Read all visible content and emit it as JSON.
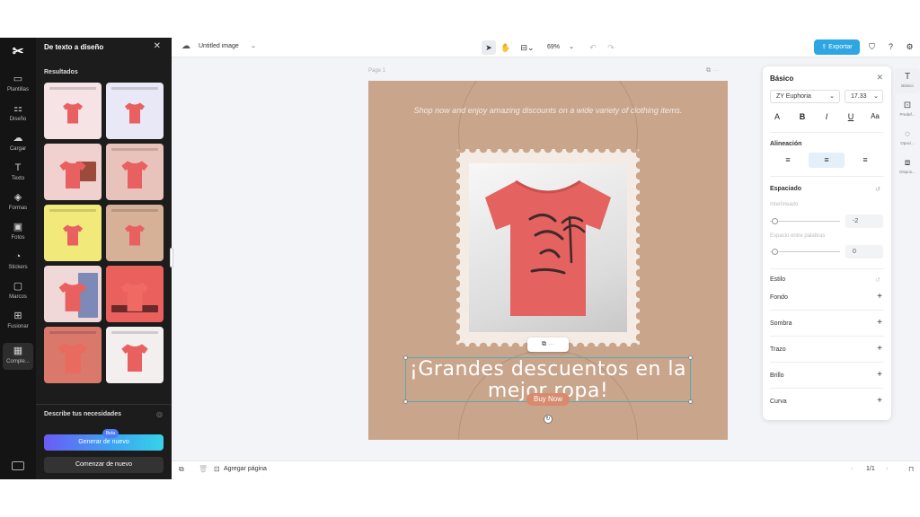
{
  "rail": {
    "items": [
      {
        "icon": "template-icon",
        "label": "Plantillas"
      },
      {
        "icon": "design-icon",
        "label": "Diseño"
      },
      {
        "icon": "upload-icon",
        "label": "Cargar"
      },
      {
        "icon": "text-icon",
        "label": "Texto"
      },
      {
        "icon": "shapes-icon",
        "label": "Formas"
      },
      {
        "icon": "photos-icon",
        "label": "Fotos"
      },
      {
        "icon": "stickers-icon",
        "label": "Stickers"
      },
      {
        "icon": "frames-icon",
        "label": "Marcos"
      },
      {
        "icon": "merge-icon",
        "label": "Fusionar"
      },
      {
        "icon": "apps-icon",
        "label": "Comple..."
      }
    ]
  },
  "left_panel": {
    "title": "De texto a diseño",
    "results_title": "Resultados",
    "describe_label": "Describe tus necesidades",
    "beta_badge": "Beta",
    "generate_button": "Generar de nuevo",
    "restart_button": "Comenzar de nuevo"
  },
  "topbar": {
    "doc_title": "Untitled image",
    "zoom": "69%",
    "export_label": "Exportar"
  },
  "canvas": {
    "page_label": "Page 1",
    "promo_text": "Shop now and enjoy amazing discounts on a wide variety of clothing items.",
    "headline": "¡Grandes descuentos en la mejor ropa!",
    "buy_button": "Buy Now",
    "colors": {
      "background": "#c9a58c",
      "accent": "#d88a6e"
    }
  },
  "bottombar": {
    "add_page": "Agregar página",
    "page_count": "1/1"
  },
  "props": {
    "title": "Básico",
    "font": "ZY Euphoria",
    "size": "17.33",
    "alignment_title": "Alineación",
    "spacing_title": "Espaciado",
    "line_spacing_label": "Interlineado",
    "line_spacing_value": "-2",
    "word_spacing_label": "Espacio entre palabras",
    "word_spacing_value": "0",
    "style_title": "Estilo",
    "style_items": [
      "Fondo",
      "Sombra",
      "Trazo",
      "Brillo",
      "Curva"
    ]
  },
  "right_strip": {
    "items": [
      "Básico",
      "Predef...",
      "Opaci...",
      "Dispos..."
    ]
  }
}
